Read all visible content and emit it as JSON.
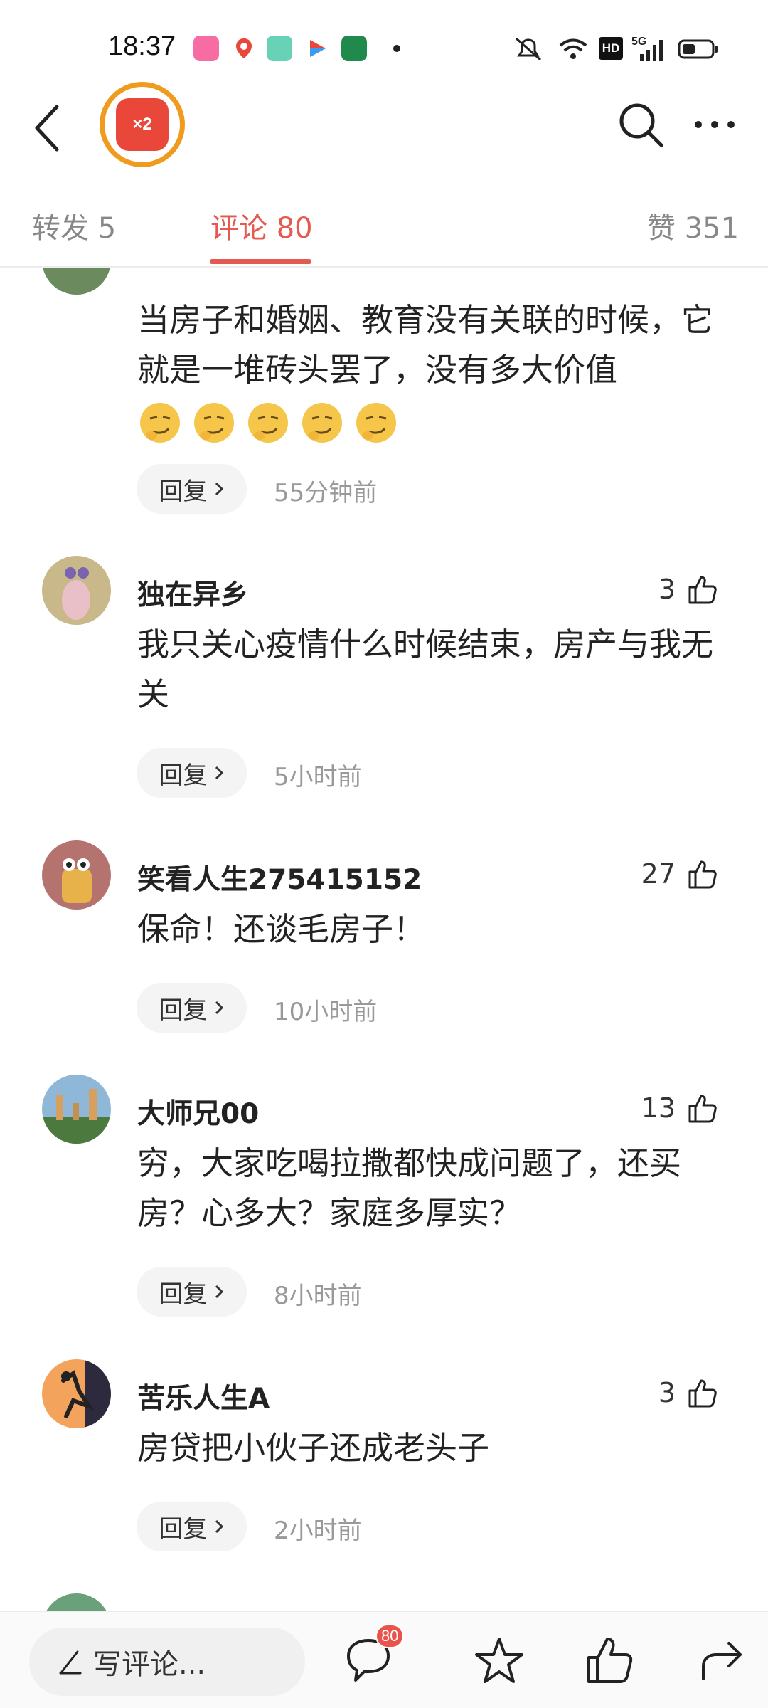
{
  "status_bar": {
    "time": "18:37",
    "app_icons": [
      "bilibili-icon",
      "map-pin-icon",
      "gallery-icon",
      "video-app-icon",
      "oppo-icon"
    ],
    "hd_label": "HD",
    "network_label": "5G"
  },
  "nav": {
    "avatar_badge": "×2"
  },
  "tabs": [
    {
      "label": "转发 5"
    },
    {
      "label": "评论 80"
    },
    {
      "label": "赞 351"
    }
  ],
  "comments": [
    {
      "name": "",
      "text": "当房子和婚姻、教育没有关联的时候，它就是一堆砖头罢了，没有多大价值",
      "emoji_count": 5,
      "reply_label": "回复",
      "time": "55分钟前"
    },
    {
      "name": "独在异乡",
      "likes": "3",
      "text": "我只关心疫情什么时候结束，房产与我无关",
      "reply_label": "回复",
      "time": "5小时前"
    },
    {
      "name": "笑看人生275415152",
      "likes": "27",
      "text": "保命！还谈毛房子！",
      "reply_label": "回复",
      "time": "10小时前"
    },
    {
      "name": "大师兄00",
      "likes": "13",
      "text": "穷，大家吃喝拉撒都快成问题了，还买房？心多大？家庭多厚实？",
      "reply_label": "回复",
      "time": "8小时前"
    },
    {
      "name": "苦乐人生A",
      "likes": "3",
      "text": "房贷把小伙子还成老头子",
      "reply_label": "回复",
      "time": "2小时前"
    }
  ],
  "bottom_bar": {
    "input_placeholder": "写评论...",
    "comment_badge": "80"
  },
  "colors": {
    "accent": "#e45a50",
    "badge": "#e9534b",
    "avatar_ring": "#f19b1e"
  }
}
